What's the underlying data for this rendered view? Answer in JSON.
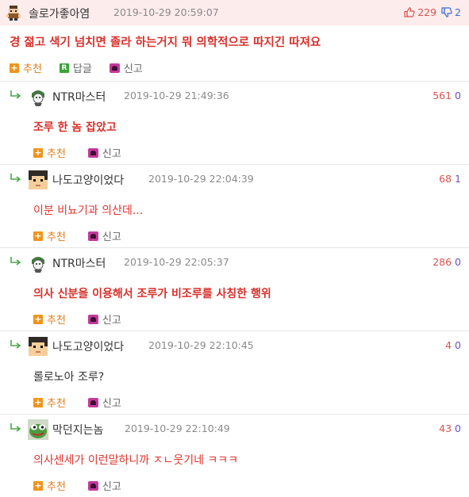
{
  "post": {
    "nickname": "솔로가좋아염",
    "date": "2019-10-29 20:59:07",
    "upvotes": "229",
    "downvotes": "2",
    "text": "경 젊고 색기 넘치면 졸라 하는거지 뭐 의학적으로 따지긴 따져요",
    "actions": {
      "recommend": "추천",
      "reply": "답글",
      "report": "신고"
    }
  },
  "comments": [
    {
      "nickname": "NTR마스터",
      "date": "2019-10-29 21:49:36",
      "up": "561",
      "down": "0",
      "text": "조루 한 놈 잡았고",
      "style": "bold"
    },
    {
      "nickname": "나도고양이었다",
      "date": "2019-10-29 22:04:39",
      "up": "68",
      "down": "1",
      "text": "이분 비뇨기과 의산데...",
      "style": "normal"
    },
    {
      "nickname": "NTR마스터",
      "date": "2019-10-29 22:05:37",
      "up": "286",
      "down": "0",
      "text": "의사 신분을 이용해서 조루가 비조루를 사칭한 행위",
      "style": "bold"
    },
    {
      "nickname": "나도고양이었다",
      "date": "2019-10-29 22:10:45",
      "up": "4",
      "down": "0",
      "text": "롤로노아 조루?",
      "style": "dark"
    },
    {
      "nickname": "막던지는놈",
      "date": "2019-10-29 22:10:49",
      "up": "43",
      "down": "0",
      "text": "의사센세가 이런말하니까 ㅈㄴ웃기네 ㅋㅋㅋ",
      "style": "normal"
    }
  ],
  "comment_actions": {
    "recommend": "추천",
    "report": "신고"
  },
  "colors": {
    "header_bg": "#fdecec",
    "highlight_text": "#d9302a",
    "recommend": "#e07b1a",
    "reply_badge": "#3aa33a",
    "report_badge": "#c3399a"
  }
}
